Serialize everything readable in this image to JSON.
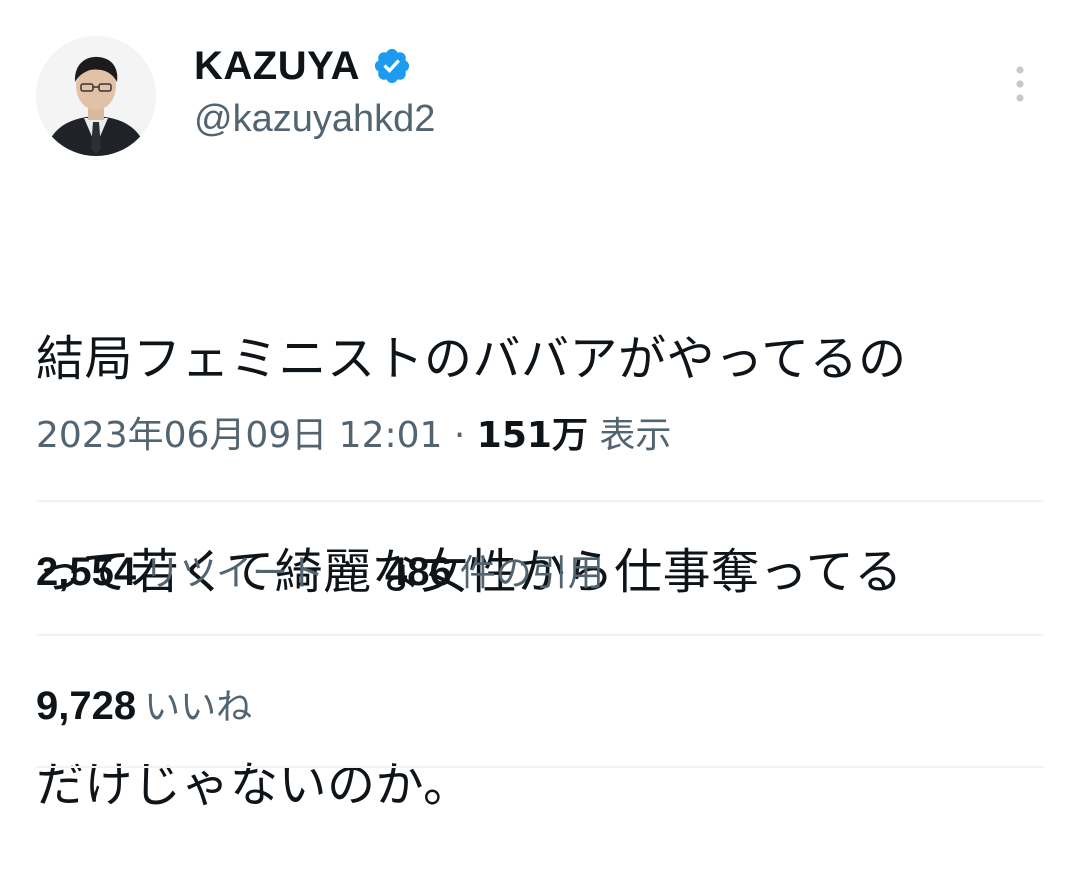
{
  "author": {
    "display_name": "KAZUYA",
    "handle": "@kazuyahkd2",
    "verified": true,
    "avatar": "profile-photo"
  },
  "icons": {
    "verified": "verified-badge-icon",
    "more": "more-options-icon"
  },
  "colors": {
    "verified_blue": "#1d9bf0",
    "text_primary": "#0f1419",
    "text_secondary": "#536471",
    "divider": "#eff3f4"
  },
  "tweet": {
    "text_lines": [
      "結局フェミニストのババアがやってるの",
      "って若くて綺麗な女性から仕事奪ってる",
      "だけじゃないのか。"
    ]
  },
  "meta": {
    "datetime": "2023年06月09日 12:01",
    "separator": "·",
    "views_count": "151万",
    "views_label": "表示"
  },
  "stats": {
    "retweets_count": "2,554",
    "retweets_label": "リツイート",
    "quotes_count": "486",
    "quotes_label": "件の引用",
    "likes_count": "9,728",
    "likes_label": "いいね"
  }
}
